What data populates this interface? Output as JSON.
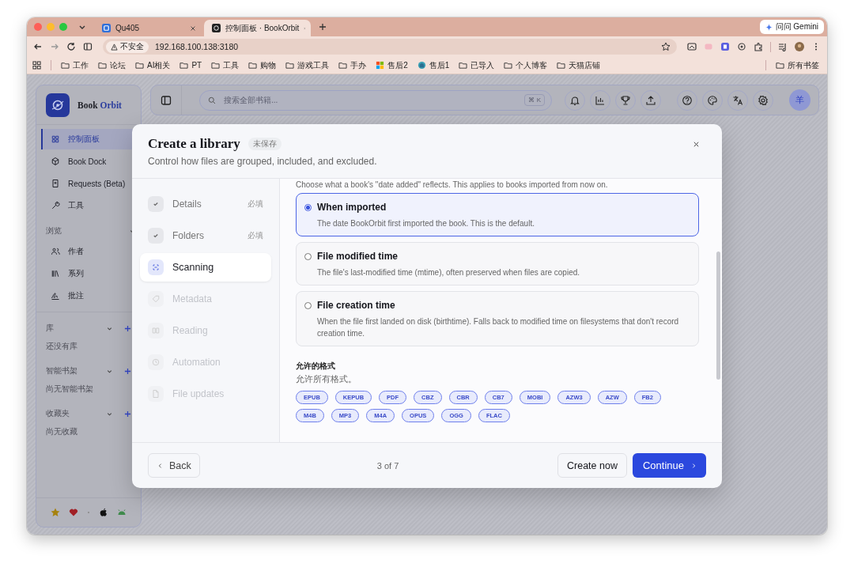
{
  "browser": {
    "tabs": [
      {
        "title": "Qu405",
        "selected": false
      },
      {
        "title": "控制面板 · BookOrbit",
        "selected": true
      }
    ],
    "assistant_button": "问问 Gemini",
    "address_bar": {
      "security": "不安全",
      "url": "192.168.100.138:3180"
    },
    "bookmarks": [
      {
        "label": "工作",
        "kind": "folder"
      },
      {
        "label": "论坛",
        "kind": "folder"
      },
      {
        "label": "AI相关",
        "kind": "folder"
      },
      {
        "label": "PT",
        "kind": "folder"
      },
      {
        "label": "工具",
        "kind": "folder"
      },
      {
        "label": "购物",
        "kind": "folder"
      },
      {
        "label": "游戏工具",
        "kind": "folder"
      },
      {
        "label": "手办",
        "kind": "folder"
      },
      {
        "label": "售后2",
        "kind": "tiles"
      },
      {
        "label": "售后1",
        "kind": "globe"
      },
      {
        "label": "已导入",
        "kind": "folder"
      },
      {
        "label": "个人博客",
        "kind": "folder"
      },
      {
        "label": "天猫店铺",
        "kind": "folder"
      }
    ],
    "all_bookmarks": "所有书签"
  },
  "sidebar": {
    "brand": {
      "first": "Book",
      "second": "Orbit"
    },
    "nav": [
      {
        "label": "控制面板",
        "selected": true
      },
      {
        "label": "Book Dock",
        "selected": false
      },
      {
        "label": "Requests (Beta)",
        "selected": false
      },
      {
        "label": "工具",
        "selected": false
      }
    ],
    "sections": [
      {
        "title": "浏览",
        "addable": false,
        "items": [
          {
            "label": "作者",
            "selected": false
          },
          {
            "label": "系列",
            "selected": false
          },
          {
            "label": "批注",
            "selected": false
          }
        ]
      },
      {
        "title": "库",
        "addable": true,
        "empty_text": "还没有库"
      },
      {
        "title": "智能书架",
        "addable": true,
        "empty_text": "尚无智能书架"
      },
      {
        "title": "收藏夹",
        "addable": true,
        "empty_text": "尚无收藏"
      }
    ]
  },
  "topbar": {
    "search": {
      "placeholder": "搜索全部书籍...",
      "shortcut": "⌘ K"
    },
    "avatar": "羊"
  },
  "dialog": {
    "title": "Create a library",
    "badge": "未保存",
    "subtitle": "Control how files are grouped, included, and excluded.",
    "steps": [
      {
        "label": "Details",
        "tag": "必填",
        "done": true,
        "selected": false
      },
      {
        "label": "Folders",
        "tag": "必填",
        "done": true,
        "selected": false
      },
      {
        "label": "Scanning",
        "done": false,
        "selected": true
      },
      {
        "label": "Metadata",
        "done": false,
        "selected": false
      },
      {
        "label": "Reading",
        "done": false,
        "selected": false
      },
      {
        "label": "Automation",
        "done": false,
        "selected": false
      },
      {
        "label": "File updates",
        "done": false,
        "selected": false
      }
    ],
    "intro": "Choose what a book's \"date added\" reflects. This applies to books imported from now on.",
    "options": [
      {
        "title": "When imported",
        "description": "The date BookOrbit first imported the book. This is the default.",
        "selected": true
      },
      {
        "title": "File modified time",
        "description": "The file's last-modified time (mtime), often preserved when files are copied.",
        "selected": false
      },
      {
        "title": "File creation time",
        "description": "When the file first landed on disk (birthtime). Falls back to modified time on filesystems that don't record creation time.",
        "selected": false
      }
    ],
    "formats_heading": "允许的格式",
    "formats_note": "允许所有格式。",
    "formats": [
      "EPUB",
      "KEPUB",
      "PDF",
      "CBZ",
      "CBR",
      "CB7",
      "MOBI",
      "AZW3",
      "AZW",
      "FB2",
      "M4B",
      "MP3",
      "M4A",
      "OPUS",
      "OGG",
      "FLAC"
    ],
    "back": "Back",
    "progress": "3 of 7",
    "create": "Create now",
    "continue": "Continue"
  }
}
